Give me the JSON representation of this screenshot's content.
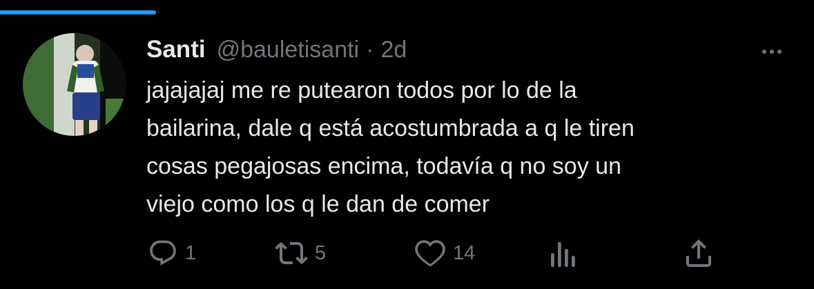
{
  "tweet": {
    "display_name": "Santi",
    "handle": "@bauletisanti",
    "separator": "·",
    "timestamp": "2d",
    "text_lines": [
      "jajajajaj me re putearon todos por lo de la",
      "bailarina, dale q está acostumbrada a q le tiren",
      "cosas pegajosas encima, todavía q no soy un",
      "viejo como los q le dan de comer"
    ]
  },
  "actions": {
    "reply_count": "1",
    "retweet_count": "5",
    "like_count": "14"
  },
  "icons": {
    "reply": "reply-icon",
    "retweet": "retweet-icon",
    "like": "heart-icon",
    "analytics": "analytics-icon",
    "share": "share-icon",
    "more": "more-icon"
  },
  "colors": {
    "background": "#000000",
    "text": "#e7e9ea",
    "secondary_text": "#71767b",
    "accent": "#1d9bf0"
  }
}
